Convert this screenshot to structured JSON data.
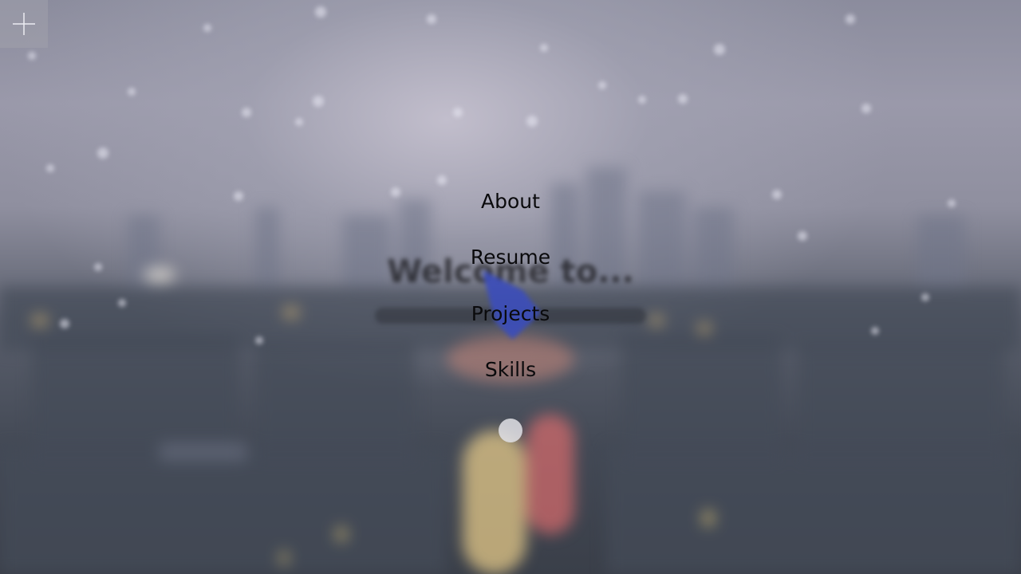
{
  "hero": {
    "title": "Welcome to..."
  },
  "corner_toggle": {
    "icon": "plus-icon"
  },
  "menu": {
    "items": [
      {
        "label": "About"
      },
      {
        "label": "Resume"
      },
      {
        "label": "Projects"
      },
      {
        "label": "Skills"
      }
    ],
    "theme_dot": {
      "icon": "circle-toggle-icon"
    }
  },
  "colors": {
    "menu_text": "#0a0a0c",
    "logo_accent": "#3e4fb8",
    "sky": "#9a99aa",
    "ground": "#3a3f49"
  }
}
